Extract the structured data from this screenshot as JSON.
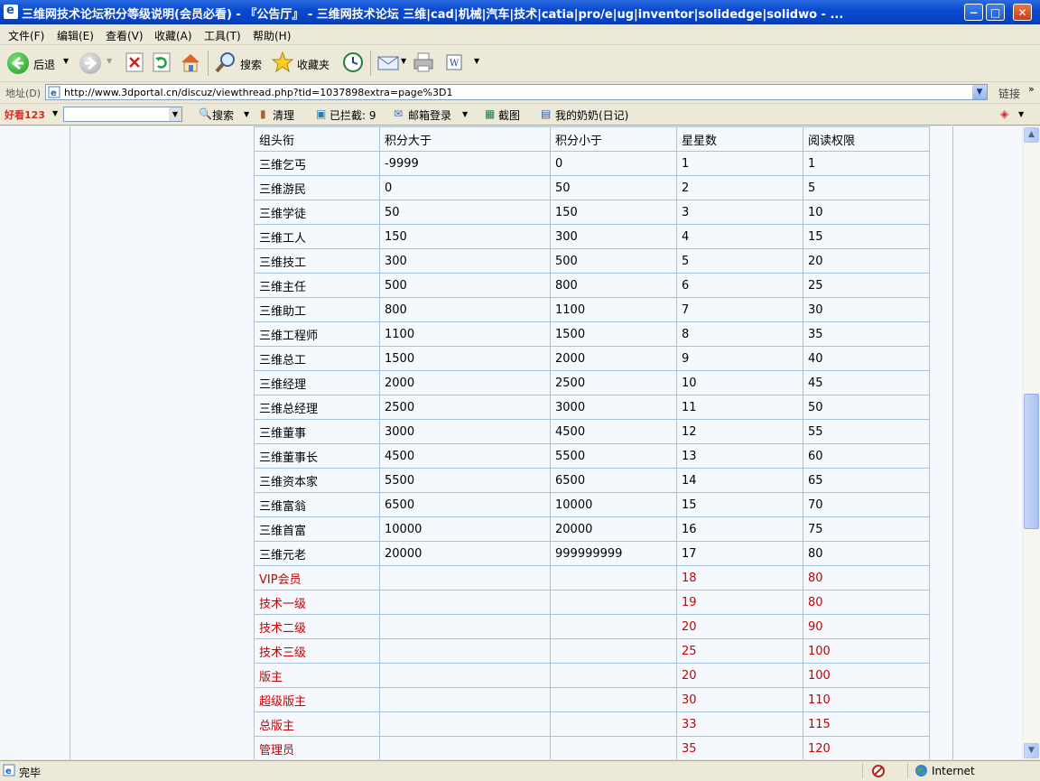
{
  "window": {
    "title": "三维网技术论坛积分等级说明(会员必看) - 『公告厅』 - 三维网技术论坛 三维|cad|机械|汽车|技术|catia|pro/e|ug|inventor|solidedge|solidwo - ...",
    "min_glyph": "−",
    "max_glyph": "□",
    "close_glyph": "✕"
  },
  "menu": {
    "items": [
      "文件(F)",
      "编辑(E)",
      "查看(V)",
      "收藏(A)",
      "工具(T)",
      "帮助(H)"
    ]
  },
  "toolbar": {
    "back_label": "后退",
    "search_label": "搜索",
    "favorites_label": "收藏夹"
  },
  "address": {
    "label": "地址(D)",
    "url": "http://www.3dportal.cn/discuz/viewthread.php?tid=1037898extra=page%3D1",
    "links_label": "链接"
  },
  "extrabar": {
    "logo_text": "好看123",
    "search_label": "搜索",
    "clean_label": "清理",
    "blocked_label": "已拦截: 9",
    "mail_label": "邮箱登录",
    "screenshot_label": "截图",
    "diary_label": "我的奶奶(日记)"
  },
  "table": {
    "rows": [
      {
        "name": "组头衔",
        "min": "积分大于",
        "max": "积分小于",
        "stars": "星星数",
        "read": "阅读权限",
        "red": false
      },
      {
        "name": "三维乞丐",
        "min": "-9999",
        "max": "0",
        "stars": "1",
        "read": "1",
        "red": false
      },
      {
        "name": "三维游民",
        "min": "0",
        "max": "50",
        "stars": "2",
        "read": "5",
        "red": false
      },
      {
        "name": "三维学徒",
        "min": "50",
        "max": "150",
        "stars": "3",
        "read": "10",
        "red": false
      },
      {
        "name": "三维工人",
        "min": "150",
        "max": "300",
        "stars": "4",
        "read": "15",
        "red": false
      },
      {
        "name": "三维技工",
        "min": "300",
        "max": "500",
        "stars": "5",
        "read": "20",
        "red": false
      },
      {
        "name": "三维主任",
        "min": "500",
        "max": "800",
        "stars": "6",
        "read": "25",
        "red": false
      },
      {
        "name": "三维助工",
        "min": "800",
        "max": "1100",
        "stars": "7",
        "read": "30",
        "red": false
      },
      {
        "name": "三维工程师",
        "min": "1100",
        "max": "1500",
        "stars": "8",
        "read": "35",
        "red": false
      },
      {
        "name": "三维总工",
        "min": "1500",
        "max": "2000",
        "stars": "9",
        "read": "40",
        "red": false
      },
      {
        "name": "三维经理",
        "min": "2000",
        "max": "2500",
        "stars": "10",
        "read": "45",
        "red": false
      },
      {
        "name": "三维总经理",
        "min": "2500",
        "max": "3000",
        "stars": "11",
        "read": "50",
        "red": false
      },
      {
        "name": "三维董事",
        "min": "3000",
        "max": "4500",
        "stars": "12",
        "read": "55",
        "red": false
      },
      {
        "name": "三维董事长",
        "min": "4500",
        "max": "5500",
        "stars": "13",
        "read": "60",
        "red": false
      },
      {
        "name": "三维资本家",
        "min": "5500",
        "max": "6500",
        "stars": "14",
        "read": "65",
        "red": false
      },
      {
        "name": "三维富翁",
        "min": "6500",
        "max": "10000",
        "stars": "15",
        "read": "70",
        "red": false
      },
      {
        "name": "三维首富",
        "min": "10000",
        "max": "20000",
        "stars": "16",
        "read": "75",
        "red": false
      },
      {
        "name": "三维元老",
        "min": "20000",
        "max": "999999999",
        "stars": "17",
        "read": "80",
        "red": false
      },
      {
        "name": "VIP会员",
        "min": "",
        "max": "",
        "stars": "18",
        "read": "80",
        "red": true
      },
      {
        "name": "技术一级",
        "min": "",
        "max": "",
        "stars": "19",
        "read": "80",
        "red": true
      },
      {
        "name": "技术二级",
        "min": "",
        "max": "",
        "stars": "20",
        "read": "90",
        "red": true
      },
      {
        "name": "技术三级",
        "min": "",
        "max": "",
        "stars": "25",
        "read": "100",
        "red": true
      },
      {
        "name": "版主",
        "min": "",
        "max": "",
        "stars": "20",
        "read": "100",
        "red": true
      },
      {
        "name": "超级版主",
        "min": "",
        "max": "",
        "stars": "30",
        "read": "110",
        "red": true
      },
      {
        "name": "总版主",
        "min": "",
        "max": "",
        "stars": "33",
        "read": "115",
        "red": true
      },
      {
        "name": "管理员",
        "min": "",
        "max": "",
        "stars": "35",
        "read": "120",
        "red": true
      }
    ]
  },
  "status": {
    "text": "完毕",
    "zone": "Internet"
  },
  "colors": {
    "accent_red": "#cc0000",
    "table_border": "#a6c4e0"
  }
}
